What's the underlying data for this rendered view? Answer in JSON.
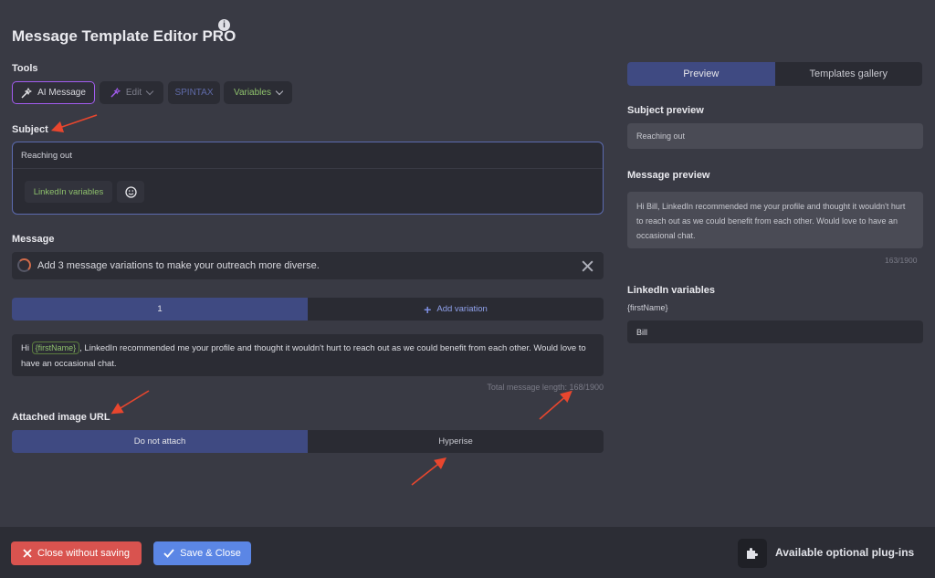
{
  "header": {
    "title": "Message Template Editor PRO",
    "info_glyph": "i"
  },
  "tools": {
    "label": "Tools",
    "ai_message": "AI Message",
    "edit": "Edit",
    "spintax": "SPINTAX",
    "variables": "Variables"
  },
  "subject": {
    "label": "Subject",
    "value": "Reaching out",
    "linkedin_variables_button": "LinkedIn variables"
  },
  "message": {
    "label": "Message",
    "banner_text": "Add 3 message variations to make your outreach more diverse.",
    "variation_tab": "1",
    "add_variation": "Add variation",
    "body_before": "Hi ",
    "body_var": "{firstName}",
    "body_after": ", LinkedIn recommended me your profile and thought it wouldn't hurt to reach out as we could benefit from each other. Would love to have an occasional chat.",
    "total_length": "Total message length: 168/1900"
  },
  "attached_image": {
    "label": "Attached image URL",
    "do_not_attach": "Do not attach",
    "hyperise": "Hyperise"
  },
  "right_panel": {
    "tab_preview": "Preview",
    "tab_templates": "Templates gallery",
    "subject_preview_label": "Subject preview",
    "subject_preview_value": "Reaching out",
    "message_preview_label": "Message preview",
    "message_preview_value": "Hi Bill, LinkedIn recommended me your profile and thought it wouldn't hurt to reach out as we could benefit from each other. Would love to have an occasional chat.",
    "counter": "163/1900",
    "linkedin_variables_label": "LinkedIn variables",
    "firstname_label": "{firstName}",
    "firstname_value": "Bill"
  },
  "footer": {
    "close_without_saving": "Close without saving",
    "save_close": "Save & Close",
    "plugins_label": "Available optional plug-ins"
  },
  "colors": {
    "background": "#393a44",
    "accent_blue": "#3f4a82",
    "variable_green": "#8ec06c",
    "danger": "#d9534f",
    "primary": "#5b86e5",
    "annotation_arrow": "#e8462e"
  },
  "icons": [
    "info-icon",
    "wand-icon",
    "chevron-down-icon",
    "emoji-icon",
    "spinner-icon",
    "close-icon",
    "plus-icon",
    "x-icon",
    "check-icon",
    "puzzle-icon",
    "arrow-annotation"
  ]
}
